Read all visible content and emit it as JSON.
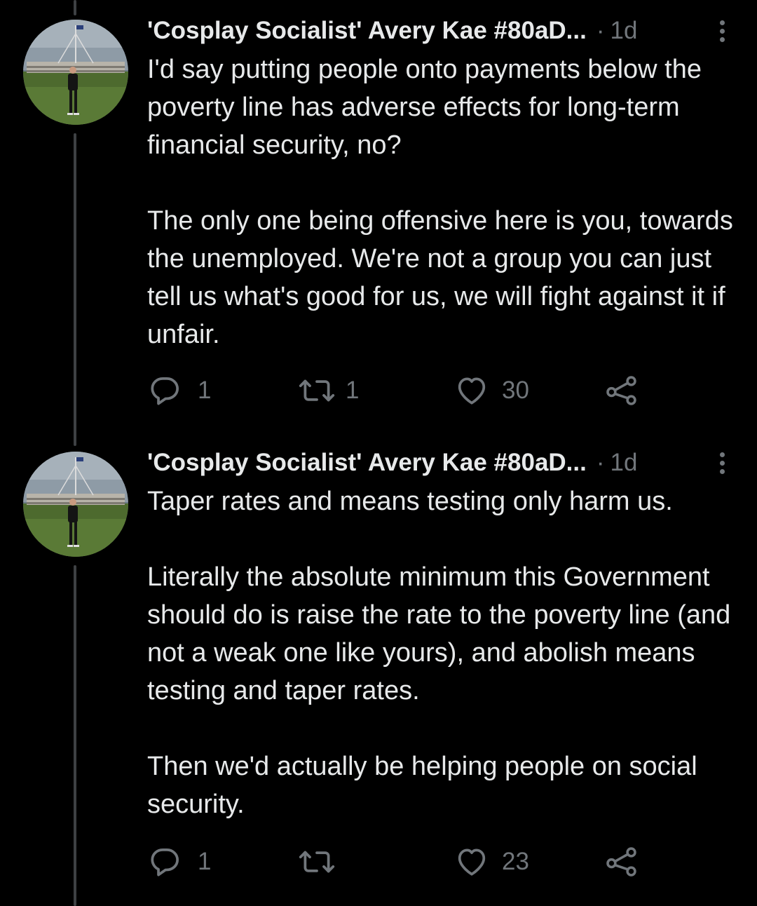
{
  "tweets": [
    {
      "author": "'Cosplay Socialist' Avery Kae #80aD...",
      "separator": "·",
      "time": "1d",
      "paragraphs": [
        "I'd say putting people onto payments below the poverty line has adverse effects for long-term financial security, no?",
        "The only one being offensive here is you, towards the unemployed. We're not a group you can just tell us what's good for us, we will fight against it if unfair."
      ],
      "replies": "1",
      "retweets": "1",
      "likes": "30"
    },
    {
      "author": "'Cosplay Socialist' Avery Kae #80aD...",
      "separator": "·",
      "time": "1d",
      "paragraphs": [
        "Taper rates and means testing only harm us.",
        "Literally the absolute minimum this Government should do is raise the rate to the poverty line (and not a weak one like yours), and abolish means testing and taper rates.",
        "Then we'd actually be helping people on social security."
      ],
      "replies": "1",
      "retweets": "",
      "likes": "23"
    }
  ],
  "icons": {
    "reply": "reply-icon",
    "retweet": "retweet-icon",
    "like": "heart-icon",
    "share": "share-icon",
    "more": "more-vertical-icon"
  },
  "colors": {
    "background": "#000000",
    "text": "#e7e9ea",
    "muted": "#71767b",
    "thread_line": "#3e4144"
  }
}
